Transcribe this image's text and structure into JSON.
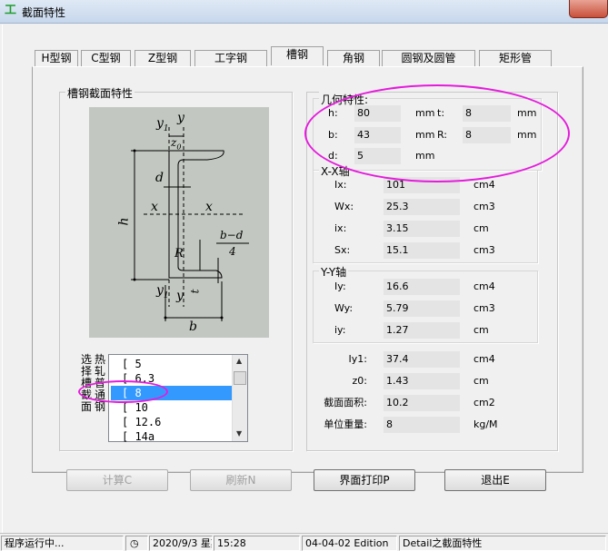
{
  "window": {
    "title": "截面特性",
    "app_icon": "steel-icon"
  },
  "tabs": [
    {
      "label": "H型钢"
    },
    {
      "label": "C型钢"
    },
    {
      "label": "Z型钢"
    },
    {
      "label": "工字钢"
    },
    {
      "label": "槽钢",
      "active": true
    },
    {
      "label": "角钢"
    },
    {
      "label": "圆钢及圆管"
    },
    {
      "label": "矩形管"
    }
  ],
  "section_group_label": "槽钢截面特性",
  "diagram_labels": {
    "y1_top": "y",
    "y1_top_sub": "1",
    "y_top": "y",
    "z0": "z",
    "z0_sub": "0",
    "d": "d",
    "h": "h",
    "x_left": "x",
    "x_right": "x",
    "R": "R",
    "t": "t",
    "bd": "b−d",
    "bd_den": "4",
    "y1_bot": "y",
    "y1_bot_sub": "1",
    "y_bot": "y",
    "b": "b"
  },
  "list": {
    "caption": [
      "选择热轧普通槽钢",
      "择",
      "热",
      "轧",
      "普",
      "通",
      "槽",
      "钢"
    ],
    "caption_cols": [
      [
        "选",
        "择",
        "槽",
        "截",
        "面"
      ],
      [
        "热",
        "轧",
        "普",
        "通",
        "钢"
      ]
    ],
    "items": [
      "[ 5",
      "[ 6.3",
      "[ 8",
      "[ 10",
      "[ 12.6",
      "[ 14a"
    ],
    "selected_index": 2
  },
  "geometry": {
    "label": "几何特性:",
    "h_label": "h:",
    "h_value": "80",
    "h_unit": "mm",
    "t_label": "t:",
    "t_value": "8",
    "t_unit": "mm",
    "b_label": "b:",
    "b_value": "43",
    "b_unit": "mm",
    "R_label": "R:",
    "R_value": "8",
    "R_unit": "mm",
    "d_label": "d:",
    "d_value": "5",
    "d_unit": "mm"
  },
  "xx_axis": {
    "label": "X-X轴",
    "rows": [
      {
        "name": "Ix:",
        "value": "101",
        "unit": "cm4"
      },
      {
        "name": "Wx:",
        "value": "25.3",
        "unit": "cm3"
      },
      {
        "name": "ix:",
        "value": "3.15",
        "unit": "cm"
      },
      {
        "name": "Sx:",
        "value": "15.1",
        "unit": "cm3"
      }
    ]
  },
  "yy_axis": {
    "label": "Y-Y轴",
    "rows": [
      {
        "name": "Iy:",
        "value": "16.6",
        "unit": "cm4"
      },
      {
        "name": "Wy:",
        "value": "5.79",
        "unit": "cm3"
      },
      {
        "name": "iy:",
        "value": "1.27",
        "unit": "cm"
      }
    ]
  },
  "other": [
    {
      "name": "Iy1:",
      "value": "37.4",
      "unit": "cm4"
    },
    {
      "name": "z0:",
      "value": "1.43",
      "unit": "cm"
    },
    {
      "name": "截面面积:",
      "value": "10.2",
      "unit": "cm2"
    },
    {
      "name": "单位重量:",
      "value": "8",
      "unit": "kg/M"
    }
  ],
  "buttons": {
    "calc": "计算C",
    "refresh": "刷新N",
    "print": "界面打印P",
    "exit": "退出E"
  },
  "status": {
    "running": "程序运行中...",
    "clock_icon": "clock-icon",
    "date": "2020/9/3 星期",
    "time": "15:28",
    "edition": "04-04-02 Edition",
    "detail": "Detail之截面特性"
  },
  "colors": {
    "annotation": "#e51bdc",
    "selection": "#3399ff",
    "diagram_bg": "#c2c8c1"
  }
}
